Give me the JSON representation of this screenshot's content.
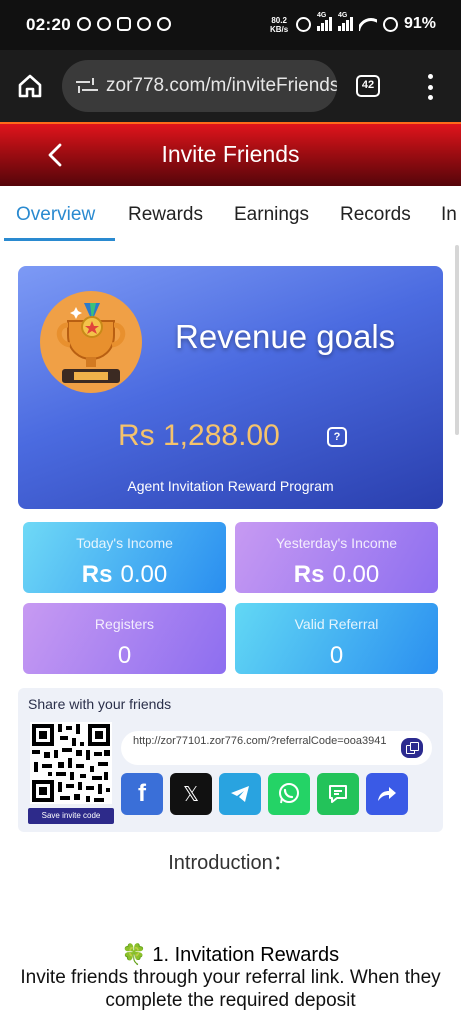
{
  "status_bar": {
    "time": "02:20",
    "net_speed_value": "80.2",
    "net_speed_unit": "KB/s",
    "signal1_label": "4G",
    "signal2_label": "4G",
    "battery": "91%"
  },
  "browser": {
    "url": "zor778.com/m/inviteFriends",
    "tab_count": "42"
  },
  "header": {
    "title": "Invite Friends"
  },
  "tabs": [
    {
      "label": "Overview",
      "active": true
    },
    {
      "label": "Rewards",
      "active": false
    },
    {
      "label": "Earnings",
      "active": false
    },
    {
      "label": "Records",
      "active": false
    },
    {
      "label": "In",
      "active": false
    }
  ],
  "revenue": {
    "title": "Revenue goals",
    "amount": "Rs 1,288.00",
    "subtitle": "Agent Invitation Reward Program",
    "help_glyph": "?"
  },
  "stats": {
    "today": {
      "label": "Today's Income",
      "currency": "Rs",
      "value": "0.00"
    },
    "yesterday": {
      "label": "Yesterday's Income",
      "currency": "Rs",
      "value": "0.00"
    },
    "registers": {
      "label": "Registers",
      "value": "0"
    },
    "valid_referral": {
      "label": "Valid Referral",
      "value": "0"
    }
  },
  "share": {
    "title": "Share with your friends",
    "link": "http://zor77101.zor776.com/?referralCode=ooa3941",
    "save_code_label": "Save invite code",
    "socials": [
      "facebook-icon",
      "x-icon",
      "telegram-icon",
      "whatsapp-icon",
      "message-icon",
      "share-icon"
    ]
  },
  "introduction": {
    "heading": "Introduction：",
    "section1_title": "🍀 1. Invitation Rewards",
    "section1_body": "Invite friends through your referral link. When they complete the required deposit"
  },
  "colors": {
    "header_red": "#d0121a",
    "tab_active": "#2a8ad0",
    "amount_gold": "#f5c36c",
    "share_panel": "#eef1f8"
  }
}
